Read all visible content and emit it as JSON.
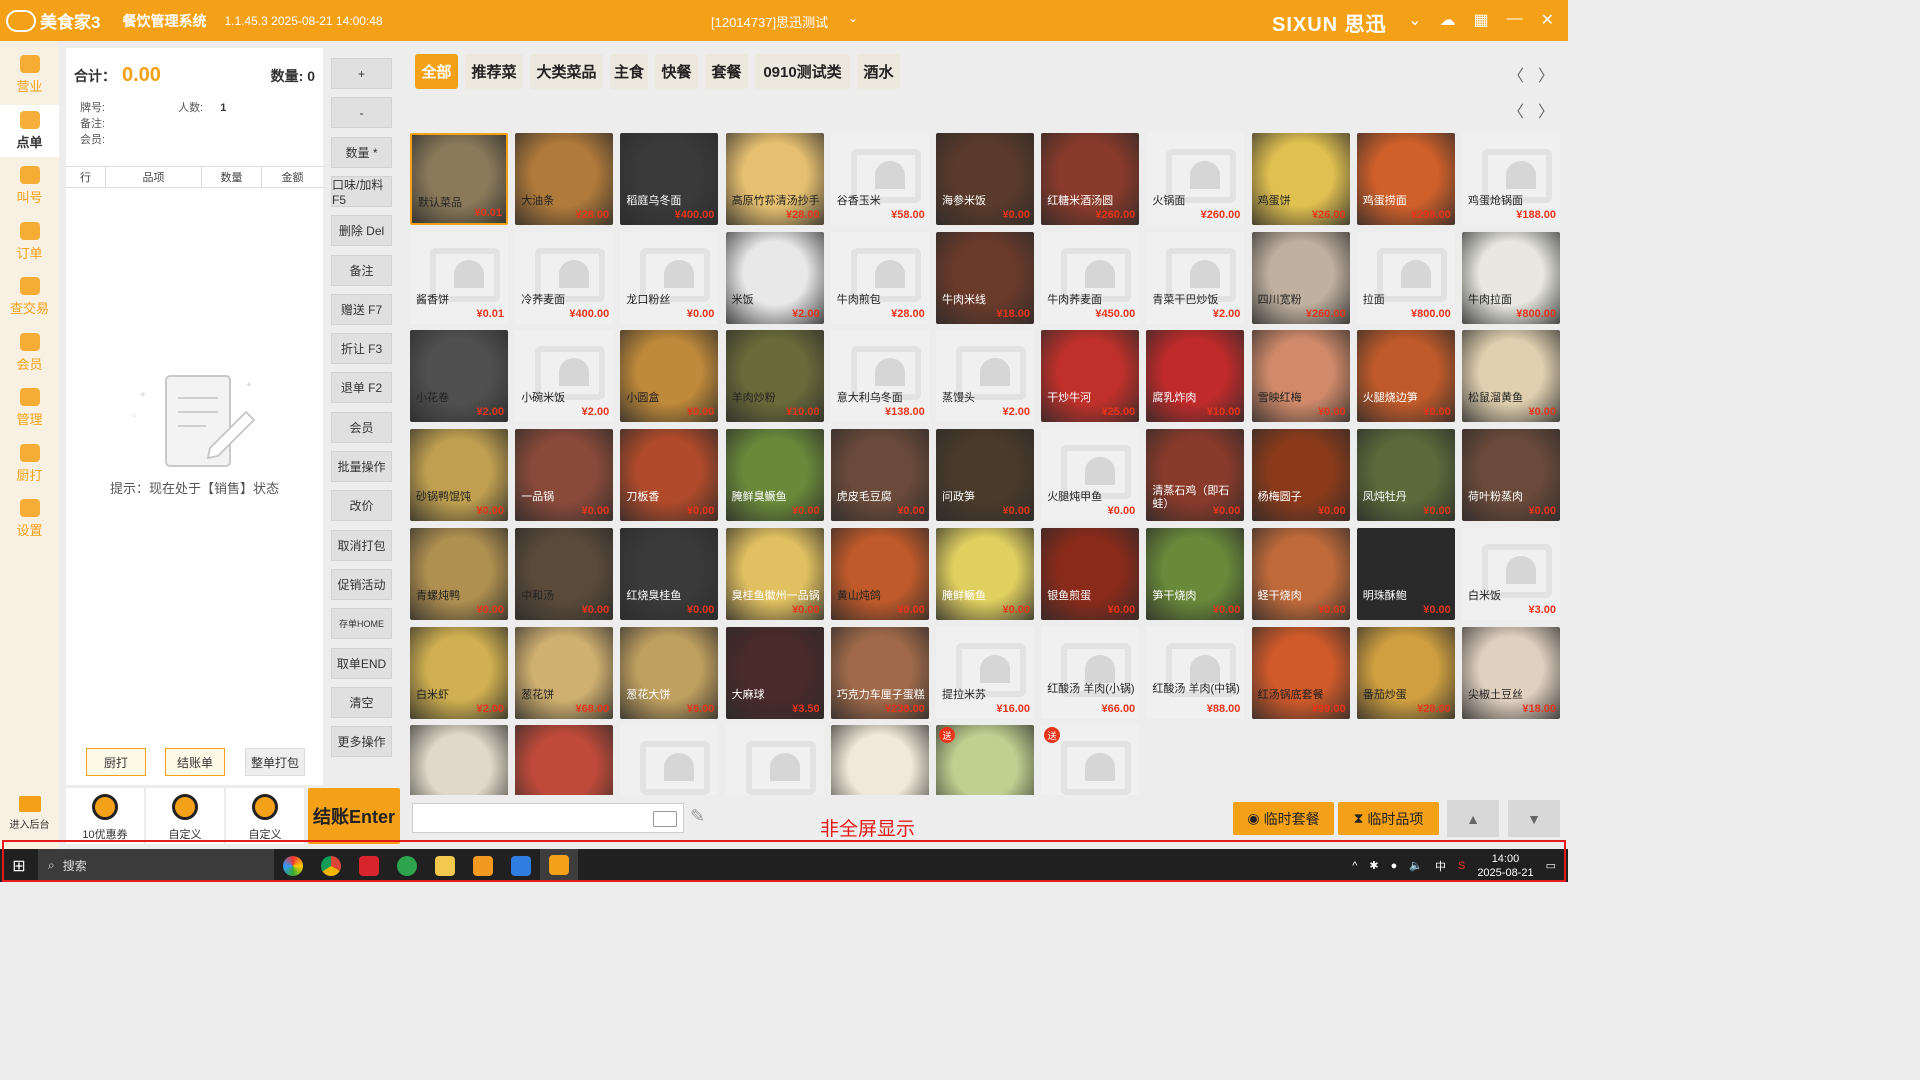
{
  "titlebar": {
    "app_name": "美食家3",
    "system_name": "餐饮管理系统",
    "version": "1.1.45.3 2025-08-21 14:00:48",
    "store": "[12014737]思迅测试",
    "brand": "SIXUN 思迅"
  },
  "sidebar": {
    "items": [
      {
        "label": "营业",
        "icon": "shop-icon"
      },
      {
        "label": "点单",
        "icon": "hand-pointer-icon"
      },
      {
        "label": "叫号",
        "icon": "number-call-icon"
      },
      {
        "label": "订单",
        "icon": "order-list-icon"
      },
      {
        "label": "查交易",
        "icon": "search-transaction-icon"
      },
      {
        "label": "会员",
        "icon": "diamond-icon"
      },
      {
        "label": "管理",
        "icon": "manage-icon"
      },
      {
        "label": "厨打",
        "icon": "kitchen-print-icon"
      },
      {
        "label": "设置",
        "icon": "gear-icon"
      }
    ],
    "backend": "进入后台"
  },
  "order": {
    "total_label": "合计：",
    "total_value": "0.00",
    "qty_label": "数量:",
    "qty_value": "0",
    "plate_label": "牌号:",
    "people_label": "人数:",
    "people_value": "1",
    "note_label": "备注:",
    "member_label": "会员:",
    "columns": [
      "行",
      "品项",
      "数量",
      "金额"
    ],
    "hint": "提示：现在处于【销售】状态",
    "btn_kitchen": "厨打",
    "btn_bill": "结账单",
    "btn_pack": "整单打包"
  },
  "bottom_tiles": [
    "10优惠券",
    "自定义",
    "自定义"
  ],
  "checkout": "结账Enter",
  "ops": [
    "+",
    "-",
    "数量 *",
    "口味/加料 F5",
    "删除 Del",
    "备注",
    "赠送 F7",
    "折让 F3",
    "退单 F2",
    "会员",
    "批量操作",
    "改价",
    "取消打包",
    "促销活动",
    "存单HOME",
    "取单END",
    "清空",
    "更多操作"
  ],
  "categories": [
    "全部",
    "推荐菜",
    "大类菜品",
    "主食",
    "快餐",
    "套餐",
    "0910测试类",
    "酒水"
  ],
  "dishes": [
    {
      "name": "默认菜品",
      "price": "¥0.01"
    },
    {
      "name": "大油条",
      "price": "¥28.00"
    },
    {
      "name": "稻庭乌冬面",
      "price": "¥400.00"
    },
    {
      "name": "高原竹荪清汤抄手",
      "price": "¥28.00"
    },
    {
      "name": "谷香玉米",
      "price": "¥58.00"
    },
    {
      "name": "海参米饭",
      "price": "¥0.00"
    },
    {
      "name": "红糖米酒汤圆",
      "price": "¥260.00"
    },
    {
      "name": "火锅面",
      "price": "¥260.00"
    },
    {
      "name": "鸡蛋饼",
      "price": "¥26.00"
    },
    {
      "name": "鸡蛋捞面",
      "price": "¥298.00"
    },
    {
      "name": "鸡蛋炝锅面",
      "price": "¥188.00"
    },
    {
      "name": "酱香饼",
      "price": "¥0.01"
    },
    {
      "name": "冷荞麦面",
      "price": "¥400.00"
    },
    {
      "name": "龙口粉丝",
      "price": "¥0.00"
    },
    {
      "name": "米饭",
      "price": "¥2.00"
    },
    {
      "name": "牛肉煎包",
      "price": "¥28.00"
    },
    {
      "name": "牛肉米线",
      "price": "¥18.00"
    },
    {
      "name": "牛肉荞麦面",
      "price": "¥450.00"
    },
    {
      "name": "青菜干巴炒饭",
      "price": "¥2.00"
    },
    {
      "name": "四川宽粉",
      "price": "¥260.00"
    },
    {
      "name": "拉面",
      "price": "¥800.00"
    },
    {
      "name": "牛肉拉面",
      "price": "¥800.00"
    },
    {
      "name": "小花卷",
      "price": "¥2.00"
    },
    {
      "name": "小碗米饭",
      "price": "¥2.00"
    },
    {
      "name": "小圆盒",
      "price": "¥0.00"
    },
    {
      "name": "羊肉炒粉",
      "price": "¥10.00"
    },
    {
      "name": "意大利乌冬面",
      "price": "¥138.00"
    },
    {
      "name": "蒸馒头",
      "price": "¥2.00"
    },
    {
      "name": "干炒牛河",
      "price": "¥25.00"
    },
    {
      "name": "腐乳炸肉",
      "price": "¥10.00"
    },
    {
      "name": "雪映红梅",
      "price": "¥0.00"
    },
    {
      "name": "火腿烧边笋",
      "price": "¥0.00"
    },
    {
      "name": "松鼠溜黄鱼",
      "price": "¥0.00"
    },
    {
      "name": "砂锅鸭馄饨",
      "price": "¥0.00"
    },
    {
      "name": "一品锅",
      "price": "¥0.00"
    },
    {
      "name": "刀板香",
      "price": "¥0.00"
    },
    {
      "name": "腌鲜臭鳜鱼",
      "price": "¥0.00"
    },
    {
      "name": "虎皮毛豆腐",
      "price": "¥0.00"
    },
    {
      "name": "问政笋",
      "price": "¥0.00"
    },
    {
      "name": "火腿炖甲鱼",
      "price": "¥0.00"
    },
    {
      "name": "清蒸石鸡（即石蛙）",
      "price": "¥0.00"
    },
    {
      "name": "杨梅圆子",
      "price": "¥0.00"
    },
    {
      "name": "凤炖牡丹",
      "price": "¥0.00"
    },
    {
      "name": "荷叶粉蒸肉",
      "price": "¥0.00"
    },
    {
      "name": "青螺炖鸭",
      "price": "¥0.00"
    },
    {
      "name": "中和汤",
      "price": "¥0.00"
    },
    {
      "name": "红烧臭桂鱼",
      "price": "¥0.00"
    },
    {
      "name": "臭桂鱼徽州一品锅",
      "price": "¥0.00"
    },
    {
      "name": "黄山炖鸽",
      "price": "¥0.00"
    },
    {
      "name": "腌鲜鳜鱼",
      "price": "¥0.00"
    },
    {
      "name": "银鱼煎蛋",
      "price": "¥0.00"
    },
    {
      "name": "笋干烧肉",
      "price": "¥0.00"
    },
    {
      "name": "蛏干烧肉",
      "price": "¥0.00"
    },
    {
      "name": "明珠酥鲍",
      "price": "¥0.00"
    },
    {
      "name": "白米饭",
      "price": "¥3.00"
    },
    {
      "name": "白米虾",
      "price": "¥2.00"
    },
    {
      "name": "葱花饼",
      "price": "¥68.00"
    },
    {
      "name": "葱花大饼",
      "price": "¥6.00"
    },
    {
      "name": "大麻球",
      "price": "¥3.50"
    },
    {
      "name": "巧克力车厘子蛋糕",
      "price": "¥238.00"
    },
    {
      "name": "提拉米苏",
      "price": "¥16.00"
    },
    {
      "name": "红酸汤 羊肉(小锅)",
      "price": "¥66.00"
    },
    {
      "name": "红酸汤 羊肉(中锅)",
      "price": "¥88.00"
    },
    {
      "name": "红汤锅底套餐",
      "price": "¥99.00"
    },
    {
      "name": "番茄炒蛋",
      "price": "¥28.00"
    },
    {
      "name": "尖椒土豆丝",
      "price": "¥18.00"
    },
    {
      "name": "",
      "price": ""
    },
    {
      "name": "",
      "price": ""
    },
    {
      "name": "",
      "price": ""
    },
    {
      "name": "",
      "price": ""
    },
    {
      "name": "",
      "price": ""
    },
    {
      "name": "",
      "price": ""
    },
    {
      "name": "",
      "price": ""
    }
  ],
  "gift_badge": "送",
  "search": {
    "placeholder": ""
  },
  "fullscreen_note": "非全屏显示",
  "btn_temp_combo": "临时套餐",
  "btn_temp_item": "临时品项",
  "taskbar": {
    "search": "搜索",
    "ime": "中",
    "time": "14:00",
    "date": "2025-08-21"
  },
  "colors": {
    "accent": "#f4a117",
    "price": "#e8341c",
    "alert": "#e31b1b"
  }
}
